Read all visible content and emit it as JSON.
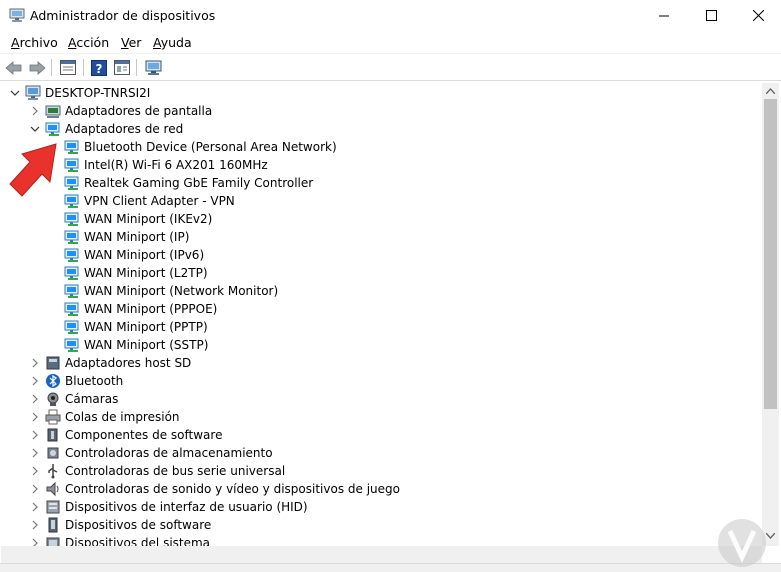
{
  "window": {
    "title": "Administrador de dispositivos"
  },
  "menu": [
    {
      "label": "Archivo",
      "accel": "A",
      "rest": "rchivo"
    },
    {
      "label": "Acción",
      "accel": "A",
      "rest": "cción"
    },
    {
      "label": "Ver",
      "accel": "V",
      "rest": "er"
    },
    {
      "label": "Ayuda",
      "accel": "A",
      "rest": "yuda"
    }
  ],
  "toolbar": {
    "icons": [
      "back-arrow-icon",
      "forward-arrow-icon",
      "properties-icon",
      "help-icon",
      "view-icon",
      "monitor-scan-icon"
    ]
  },
  "tree": {
    "root": "DESKTOP-TNRSI2I",
    "items": [
      {
        "label": "Adaptadores de pantalla",
        "icon": "display-adapter-icon",
        "expanded": false
      },
      {
        "label": "Adaptadores de red",
        "icon": "network-adapter-icon",
        "expanded": true,
        "children": [
          "Bluetooth Device (Personal Area Network)",
          "Intel(R) Wi-Fi 6 AX201 160MHz",
          "Realtek Gaming GbE Family Controller",
          "VPN Client Adapter - VPN",
          "WAN Miniport (IKEv2)",
          "WAN Miniport (IP)",
          "WAN Miniport (IPv6)",
          "WAN Miniport (L2TP)",
          "WAN Miniport (Network Monitor)",
          "WAN Miniport (PPPOE)",
          "WAN Miniport (PPTP)",
          "WAN Miniport (SSTP)"
        ]
      },
      {
        "label": "Adaptadores host SD",
        "icon": "sd-host-icon",
        "expanded": false
      },
      {
        "label": "Bluetooth",
        "icon": "bluetooth-icon",
        "expanded": false
      },
      {
        "label": "Cámaras",
        "icon": "camera-icon",
        "expanded": false
      },
      {
        "label": "Colas de impresión",
        "icon": "printer-icon",
        "expanded": false
      },
      {
        "label": "Componentes de software",
        "icon": "software-component-icon",
        "expanded": false
      },
      {
        "label": "Controladoras de almacenamiento",
        "icon": "storage-controller-icon",
        "expanded": false
      },
      {
        "label": "Controladoras de bus serie universal",
        "icon": "usb-icon",
        "expanded": false
      },
      {
        "label": "Controladoras de sonido y vídeo y dispositivos de juego",
        "icon": "speaker-icon",
        "expanded": false
      },
      {
        "label": "Dispositivos de interfaz de usuario (HID)",
        "icon": "hid-icon",
        "expanded": false
      },
      {
        "label": "Dispositivos de software",
        "icon": "software-device-icon",
        "expanded": false
      },
      {
        "label": "Dispositivos del sistema",
        "icon": "system-device-icon",
        "expanded": false
      }
    ]
  },
  "colors": {
    "accent_arrow": "#e8322b",
    "network_icon": "#1e90ff",
    "scroll_thumb": "#c1c1c1"
  }
}
